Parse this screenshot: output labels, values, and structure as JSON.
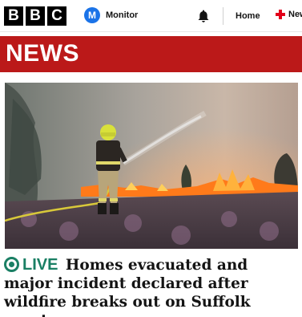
{
  "header": {
    "logo_letters": [
      "B",
      "B",
      "C"
    ],
    "monitor_badge": "M",
    "monitor_label": "Monitor",
    "notifications_icon": "bell-icon",
    "nav_home": "Home",
    "nav_news": "News"
  },
  "banner": {
    "title": "NEWS",
    "color": "#bb1919"
  },
  "article": {
    "live_label": "LIVE",
    "headline": "Homes evacuated and major incident declared after wildfire breaks out on Suffolk coast",
    "image_description_icon": "firefighter-wildfire-photo",
    "accent_color": "#1a7f64"
  }
}
